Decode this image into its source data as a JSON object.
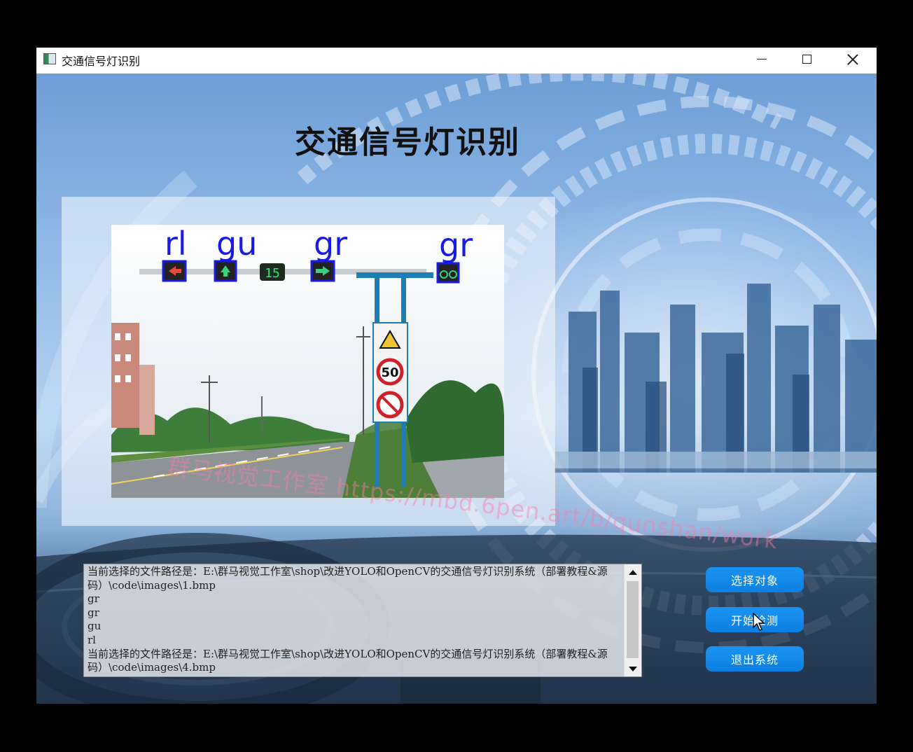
{
  "window": {
    "title": "交通信号灯识别"
  },
  "app": {
    "heading": "交通信号灯识别"
  },
  "detection": {
    "labels": [
      "rl",
      "gu",
      "gr",
      "gr"
    ],
    "countdown_display": "15",
    "speed_limit_sign": "50",
    "watermark": "群马视觉工作室 https://mbd.6pen.art/b/qunshan/work"
  },
  "log": {
    "lines": [
      "当前选择的文件路径是：E:\\群马视觉工作室\\shop\\改进YOLO和OpenCV的交通信号灯识别系统（部署教程&源码）\\code\\images\\1.bmp",
      "gr",
      "gr",
      "gu",
      "rl",
      "当前选择的文件路径是：E:\\群马视觉工作室\\shop\\改进YOLO和OpenCV的交通信号灯识别系统（部署教程&源码）\\code\\images\\4.bmp"
    ]
  },
  "buttons": {
    "select": "选择对象",
    "start": "开始检测",
    "exit": "退出系统"
  },
  "colors": {
    "button": "#0c7fe0",
    "detection_box": "#1a1ae6"
  }
}
